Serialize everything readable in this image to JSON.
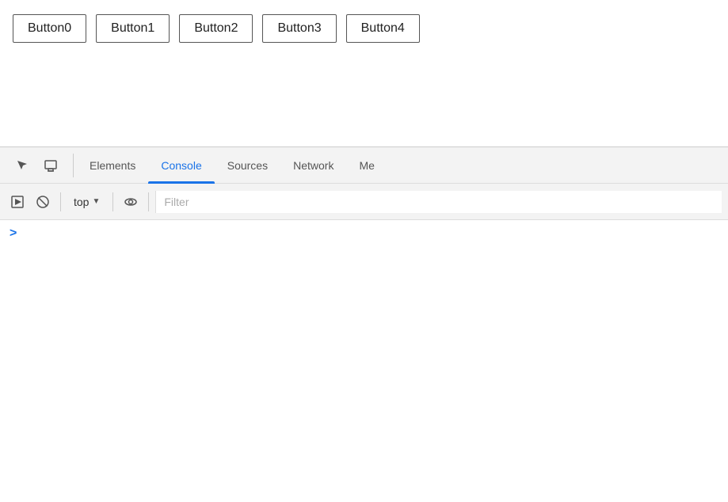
{
  "page": {
    "buttons": [
      {
        "label": "Button0"
      },
      {
        "label": "Button1"
      },
      {
        "label": "Button2"
      },
      {
        "label": "Button3"
      },
      {
        "label": "Button4"
      }
    ]
  },
  "devtools": {
    "tabs": [
      {
        "label": "Elements",
        "active": false
      },
      {
        "label": "Console",
        "active": true
      },
      {
        "label": "Sources",
        "active": false
      },
      {
        "label": "Network",
        "active": false
      },
      {
        "label": "Me",
        "active": false
      }
    ],
    "toolbar": {
      "context": "top",
      "filter_placeholder": "Filter"
    },
    "console": {
      "prompt": ">"
    }
  }
}
